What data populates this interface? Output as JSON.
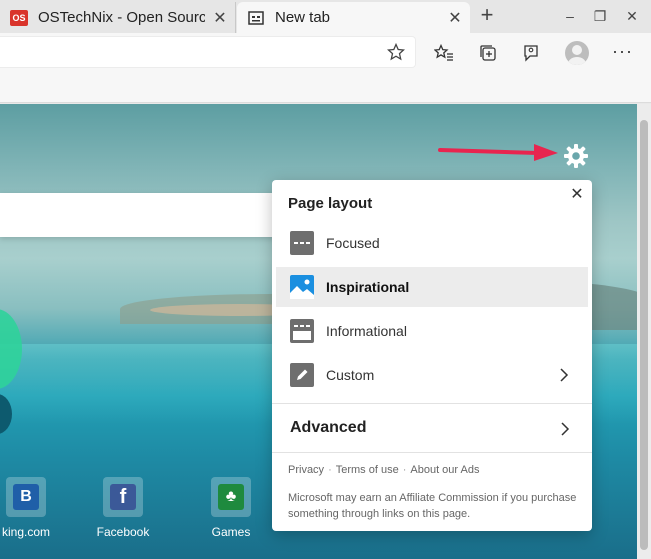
{
  "tabs": [
    {
      "title": "OSTechNix - Open Source",
      "favicon": "os-favicon",
      "favicon_text": "OS",
      "active": false
    },
    {
      "title": "New tab",
      "favicon": "newtab-page-icon",
      "active": true
    }
  ],
  "window": {
    "new_tab": "+",
    "minimize": "–",
    "restore": "❐",
    "close": "✕"
  },
  "toolbar": {
    "more": "···"
  },
  "panel": {
    "title": "Page layout",
    "close": "✕",
    "options": [
      {
        "label": "Focused",
        "icon": "focused-layout-icon",
        "selected": false
      },
      {
        "label": "Inspirational",
        "icon": "inspirational-layout-icon",
        "selected": true
      },
      {
        "label": "Informational",
        "icon": "informational-layout-icon",
        "selected": false
      },
      {
        "label": "Custom",
        "icon": "custom-pencil-icon",
        "selected": false
      }
    ],
    "advanced": "Advanced",
    "links": [
      "Privacy",
      "Terms of use",
      "About our Ads"
    ],
    "disclaimer": "Microsoft may earn an Affiliate Commission if you purchase something through links on this page."
  },
  "quicklinks": [
    {
      "label": "king.com",
      "letter": "B",
      "color": "#1f5fa8"
    },
    {
      "label": "Facebook",
      "letter": "f",
      "color": "#3b5998"
    },
    {
      "label": "Games",
      "letter": "♣",
      "color": "#1e8a3e"
    }
  ],
  "colors": {
    "accent_arrow": "#e8254f",
    "selected_row": "#ececec"
  }
}
